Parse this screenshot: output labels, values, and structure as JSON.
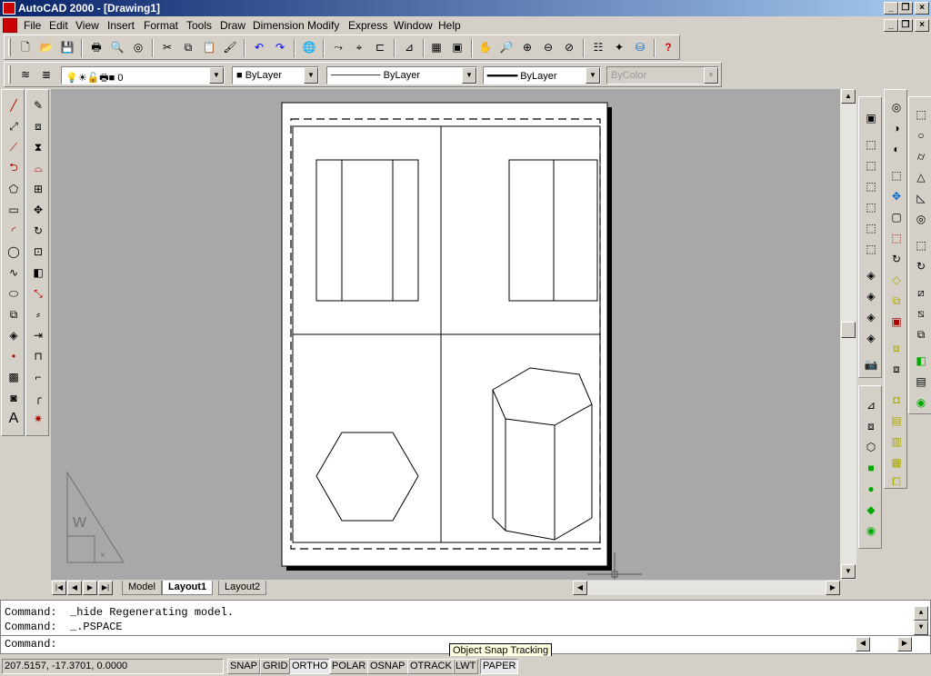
{
  "window": {
    "title": "AutoCAD 2000 - [Drawing1]"
  },
  "menu": {
    "items": [
      "File",
      "Edit",
      "View",
      "Insert",
      "Format",
      "Tools",
      "Draw",
      "Dimension",
      "Modify",
      "Express",
      "Window",
      "Help"
    ]
  },
  "properties": {
    "layer": "0",
    "color": "ByLayer",
    "linetype": "ByLayer",
    "lineweight": "ByLayer",
    "plotstyle": "ByColor"
  },
  "tabs": {
    "model": "Model",
    "layout1": "Layout1",
    "layout2": "Layout2",
    "active": "Layout1"
  },
  "command": {
    "history": [
      "Command:  _hide Regenerating model.",
      "Command:  _.PSPACE"
    ],
    "prompt": "Command:",
    "input": ""
  },
  "tooltip": {
    "text": "Object Snap Tracking"
  },
  "status": {
    "coords": "207.5157,  -17.3701, 0.0000",
    "toggles": [
      "SNAP",
      "GRID",
      "ORTHO",
      "POLAR",
      "OSNAP",
      "OTRACK",
      "LWT",
      "PAPER"
    ],
    "active_toggles": [
      "ORTHO",
      "PAPER"
    ]
  },
  "icons": {
    "standard_toolbar": [
      "new-icon",
      "open-icon",
      "save-icon",
      "print-icon",
      "print-preview-icon",
      "publish-icon",
      "cut-icon",
      "copy-icon",
      "paste-icon",
      "match-properties-icon",
      "undo-icon",
      "redo-icon",
      "web-icon",
      "snap-from-icon",
      "osnap-icon",
      "ucs-icon",
      "distance-icon",
      "named-views-icon",
      "aerial-view-icon",
      "pan-icon",
      "zoom-realtime-icon",
      "zoom-window-icon",
      "zoom-previous-icon",
      "properties-icon",
      "design-center-icon",
      "dbconnect-icon",
      "help-icon"
    ],
    "draw_toolbar": [
      "line-icon",
      "construction-line-icon",
      "polyline-icon",
      "polygon-icon",
      "rectangle-icon",
      "arc-icon",
      "circle-icon",
      "spline-icon",
      "ellipse-icon",
      "insert-block-icon",
      "make-block-icon",
      "point-icon",
      "hatch-icon",
      "region-icon",
      "mtext-icon"
    ],
    "modify_toolbar": [
      "erase-icon",
      "copy-object-icon",
      "mirror-icon",
      "offset-icon",
      "array-icon",
      "move-icon",
      "rotate-icon",
      "scale-icon",
      "stretch-icon",
      "lengthen-icon",
      "trim-icon",
      "extend-icon",
      "break-icon",
      "chamfer-icon",
      "fillet-icon",
      "explode-icon"
    ]
  }
}
